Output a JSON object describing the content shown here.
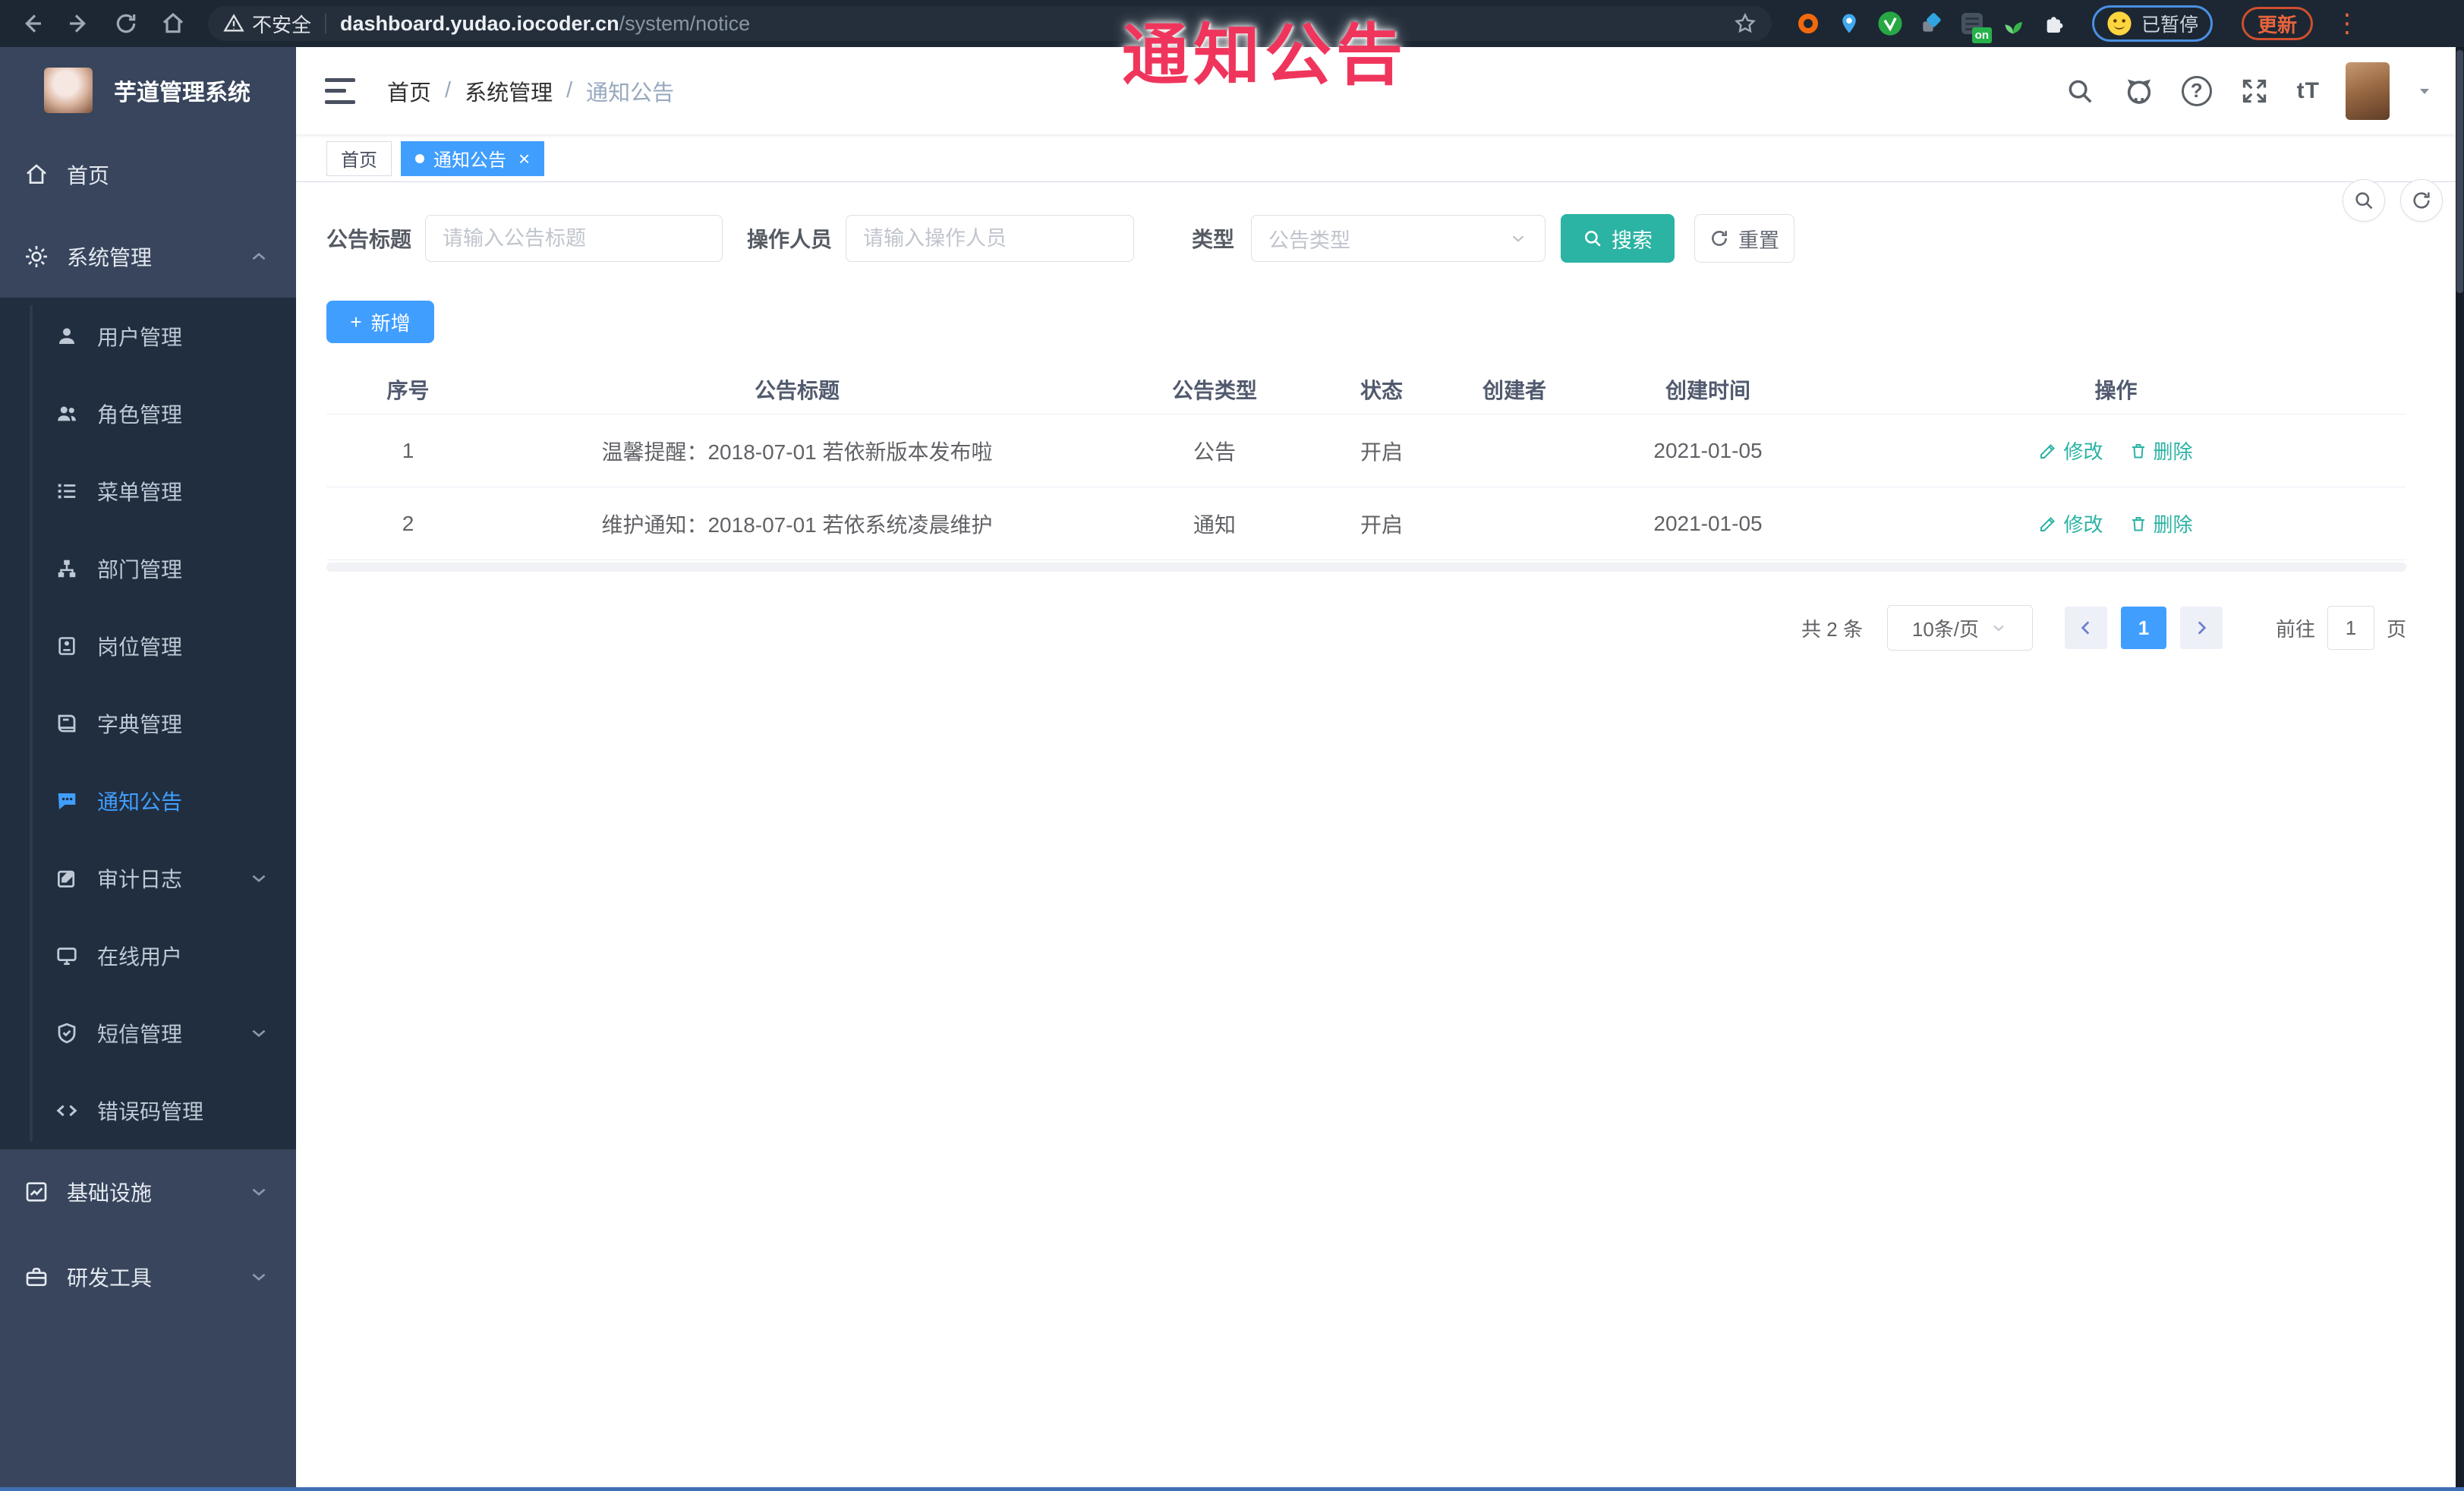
{
  "browser": {
    "security_label": "不安全",
    "url_host": "dashboard.yudao.iocoder.cn",
    "url_path": "/system/notice",
    "extension_on_badge": "on",
    "paused_label": "已暂停",
    "update_label": "更新"
  },
  "annotation": {
    "text": "通知公告"
  },
  "sidebar": {
    "logo_title": "芋道管理系统",
    "items": [
      {
        "label": "首页"
      },
      {
        "label": "系统管理"
      },
      {
        "label": "用户管理"
      },
      {
        "label": "角色管理"
      },
      {
        "label": "菜单管理"
      },
      {
        "label": "部门管理"
      },
      {
        "label": "岗位管理"
      },
      {
        "label": "字典管理"
      },
      {
        "label": "通知公告"
      },
      {
        "label": "审计日志"
      },
      {
        "label": "在线用户"
      },
      {
        "label": "短信管理"
      },
      {
        "label": "错误码管理"
      },
      {
        "label": "基础设施"
      },
      {
        "label": "研发工具"
      }
    ]
  },
  "header": {
    "breadcrumb": [
      "首页",
      "系统管理",
      "通知公告"
    ],
    "breadcrumb_separator": "/",
    "font_icon_text": "tT",
    "question_glyph": "?"
  },
  "tabs": [
    {
      "label": "首页"
    },
    {
      "label": "通知公告"
    }
  ],
  "glyphs": {
    "tab_close": "×",
    "plus": "+",
    "kebab": "⋮"
  },
  "filters": {
    "title_label": "公告标题",
    "title_placeholder": "请输入公告标题",
    "operator_label": "操作人员",
    "operator_placeholder": "请输入操作人员",
    "type_label": "类型",
    "type_placeholder": "公告类型",
    "search_label": "搜索",
    "reset_label": "重置"
  },
  "toolbar": {
    "add_label": "新增"
  },
  "table": {
    "headers": [
      "序号",
      "公告标题",
      "公告类型",
      "状态",
      "创建者",
      "创建时间",
      "操作"
    ],
    "rows": [
      {
        "no": "1",
        "title": "温馨提醒：2018-07-01 若依新版本发布啦",
        "type": "公告",
        "status": "开启",
        "creator": "",
        "created_at": "2021-01-05"
      },
      {
        "no": "2",
        "title": "维护通知：2018-07-01 若依系统凌晨维护",
        "type": "通知",
        "status": "开启",
        "creator": "",
        "created_at": "2021-01-05"
      }
    ],
    "edit_label": "修改",
    "delete_label": "删除"
  },
  "pagination": {
    "total_text": "共 2 条",
    "page_size_text": "10条/页",
    "current_page": "1",
    "goto_label": "前往",
    "goto_value": "1",
    "goto_unit": "页"
  },
  "colors": {
    "primary": "#409eff",
    "search_teal": "#2bb3a3",
    "annotation_red": "#f0355c",
    "sidebar_bg": "#38455c",
    "submenu_bg": "#212e3f"
  }
}
